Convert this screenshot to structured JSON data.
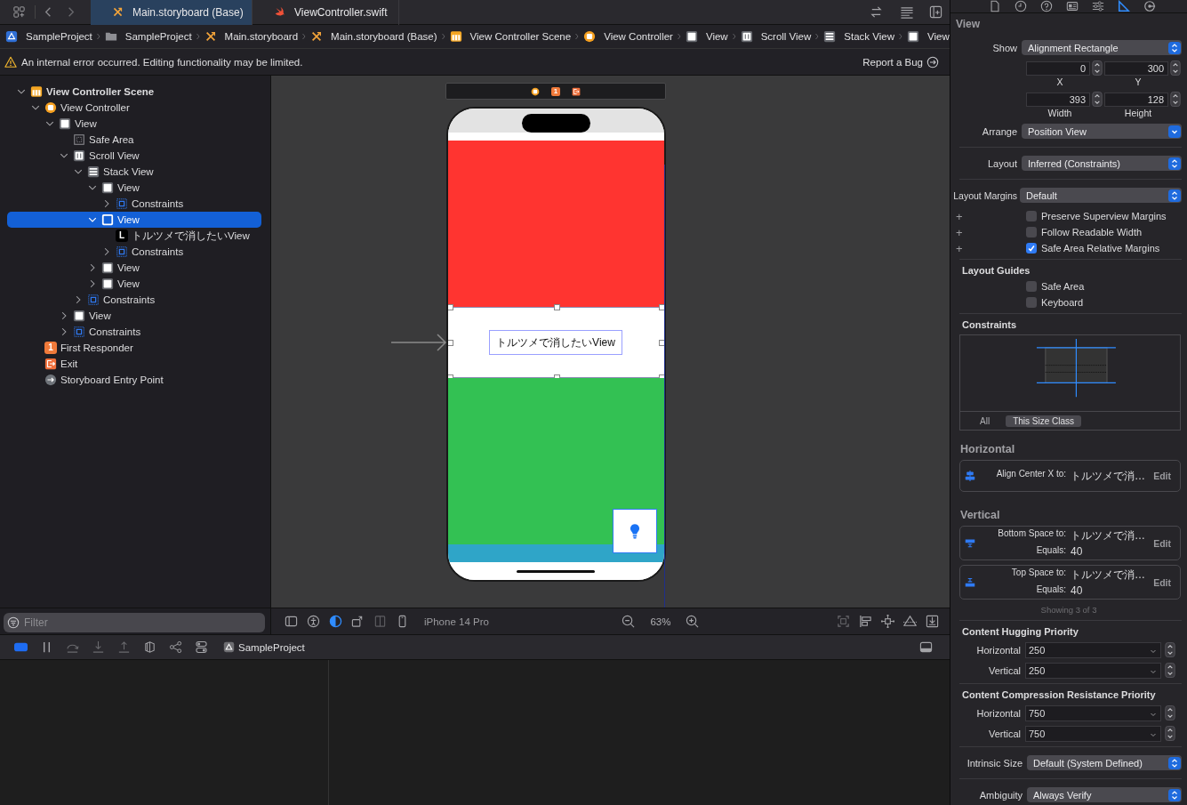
{
  "toolbar": {
    "editor_tabs": [
      {
        "label": "Main.storyboard (Base)",
        "kind": "storyboard",
        "selected": true
      },
      {
        "label": "ViewController.swift",
        "kind": "swift",
        "selected": false
      }
    ]
  },
  "breadcrumb": [
    {
      "label": "SampleProject",
      "kind": "project"
    },
    {
      "label": "SampleProject",
      "kind": "folder"
    },
    {
      "label": "Main.storyboard",
      "kind": "storyboard"
    },
    {
      "label": "Main.storyboard (Base)",
      "kind": "storyboard"
    },
    {
      "label": "View Controller Scene",
      "kind": "scene"
    },
    {
      "label": "View Controller",
      "kind": "controller"
    },
    {
      "label": "View",
      "kind": "view"
    },
    {
      "label": "Scroll View",
      "kind": "scroll"
    },
    {
      "label": "Stack View",
      "kind": "stack"
    },
    {
      "label": "View",
      "kind": "view"
    }
  ],
  "warning": {
    "message": "An internal error occurred. Editing functionality may be limited.",
    "action": "Report a Bug"
  },
  "outline": {
    "filter_placeholder": "Filter",
    "items": [
      {
        "label": "View Controller Scene",
        "kind": "scene",
        "expanded": true,
        "selected": false,
        "children": [
          {
            "label": "View Controller",
            "kind": "controller",
            "expanded": true,
            "selected": false,
            "children": [
              {
                "label": "View",
                "kind": "view",
                "expanded": true,
                "selected": false,
                "children": [
                  {
                    "label": "Safe Area",
                    "kind": "safe_area",
                    "selected": false
                  },
                  {
                    "label": "Scroll View",
                    "kind": "scroll",
                    "expanded": true,
                    "selected": false,
                    "children": [
                      {
                        "label": "Stack View",
                        "kind": "stack",
                        "expanded": true,
                        "selected": false,
                        "children": [
                          {
                            "label": "View",
                            "kind": "view",
                            "expanded": true,
                            "selected": false,
                            "children": [
                              {
                                "label": "Constraints",
                                "kind": "constraints",
                                "expanded": false,
                                "selected": false
                              }
                            ]
                          },
                          {
                            "label": "View",
                            "kind": "view",
                            "expanded": true,
                            "selected": true,
                            "children": [
                              {
                                "label": "トルツメで消したいView",
                                "kind": "label",
                                "glyph": "L",
                                "selected": false
                              },
                              {
                                "label": "Constraints",
                                "kind": "constraints",
                                "expanded": false,
                                "selected": false
                              }
                            ]
                          },
                          {
                            "label": "View",
                            "kind": "view",
                            "expanded": false,
                            "selected": false
                          },
                          {
                            "label": "View",
                            "kind": "view",
                            "expanded": false,
                            "selected": false
                          }
                        ]
                      },
                      {
                        "label": "Constraints",
                        "kind": "constraints",
                        "expanded": false,
                        "selected": false
                      }
                    ]
                  },
                  {
                    "label": "View",
                    "kind": "view",
                    "expanded": false,
                    "selected": false
                  },
                  {
                    "label": "Constraints",
                    "kind": "constraints",
                    "expanded": false,
                    "selected": false
                  }
                ]
              }
            ]
          },
          {
            "label": "First Responder",
            "kind": "responder",
            "glyph": "1",
            "selected": false
          },
          {
            "label": "Exit",
            "kind": "exit",
            "selected": false
          },
          {
            "label": "Storyboard Entry Point",
            "kind": "entry",
            "selected": false
          }
        ]
      }
    ]
  },
  "canvas": {
    "scene_dock": [
      {
        "kind": "controller"
      },
      {
        "kind": "responder",
        "glyph": "1"
      },
      {
        "kind": "exit"
      }
    ],
    "label_text": "トルツメで消したいView",
    "device": "iPhone 14 Pro",
    "zoom": "63%"
  },
  "debug_bar": {
    "target": "SampleProject"
  },
  "inspector": {
    "tabs": [
      {
        "selected": false
      },
      {
        "selected": false
      },
      {
        "selected": false
      },
      {
        "selected": false
      },
      {
        "selected": false
      },
      {
        "selected": true
      },
      {
        "selected": false
      }
    ],
    "title": "View",
    "show": {
      "label": "Show",
      "value": "Alignment Rectangle"
    },
    "frame": [
      {
        "label": "X",
        "value": "0"
      },
      {
        "label": "Y",
        "value": "300"
      },
      {
        "label": "Width",
        "value": "393"
      },
      {
        "label": "Height",
        "value": "128"
      }
    ],
    "arrange": {
      "label": "Arrange",
      "value": "Position View",
      "kind": "pulldown"
    },
    "layout": {
      "label": "Layout",
      "value": "Inferred (Constraints)"
    },
    "layout_margins": {
      "label": "Layout Margins",
      "value": "Default",
      "options": [
        {
          "add": "+",
          "label": "Preserve Superview Margins",
          "checked": false
        },
        {
          "add": "+",
          "label": "Follow Readable Width",
          "checked": false
        },
        {
          "add": "+",
          "label": "Safe Area Relative Margins",
          "checked": true
        }
      ]
    },
    "layout_guides": {
      "title": "Layout Guides",
      "options": [
        {
          "label": "Safe Area",
          "checked": false
        },
        {
          "label": "Keyboard",
          "checked": false
        }
      ]
    },
    "constraints": {
      "title": "Constraints",
      "filters": [
        {
          "label": "All",
          "selected": false
        },
        {
          "label": "This Size Class",
          "selected": true
        }
      ]
    },
    "constraint_groups": [
      {
        "title": "Horizontal",
        "items": [
          {
            "kind": "align_center_x",
            "relation": "Align Center X to:",
            "target": "トルツメで消…",
            "action": "Edit"
          }
        ]
      },
      {
        "title": "Vertical",
        "items": [
          {
            "kind": "bottom_space",
            "relation": "Bottom Space to:",
            "target": "トルツメで消…",
            "equals_label": "Equals:",
            "equals": "40",
            "action": "Edit"
          },
          {
            "kind": "top_space",
            "relation": "Top Space to:",
            "target": "トルツメで消…",
            "equals_label": "Equals:",
            "equals": "40",
            "action": "Edit"
          }
        ]
      }
    ],
    "constraints_count": "Showing 3 of 3",
    "priorities": [
      {
        "title": "Content Hugging Priority",
        "rows": [
          {
            "label": "Horizontal",
            "value": "250"
          },
          {
            "label": "Vertical",
            "value": "250"
          }
        ]
      },
      {
        "title": "Content Compression Resistance Priority",
        "rows": [
          {
            "label": "Horizontal",
            "value": "750"
          },
          {
            "label": "Vertical",
            "value": "750"
          }
        ]
      }
    ],
    "intrinsic_size": {
      "label": "Intrinsic Size",
      "value": "Default (System Defined)"
    },
    "ambiguity": {
      "label": "Ambiguity",
      "value": "Always Verify"
    }
  }
}
